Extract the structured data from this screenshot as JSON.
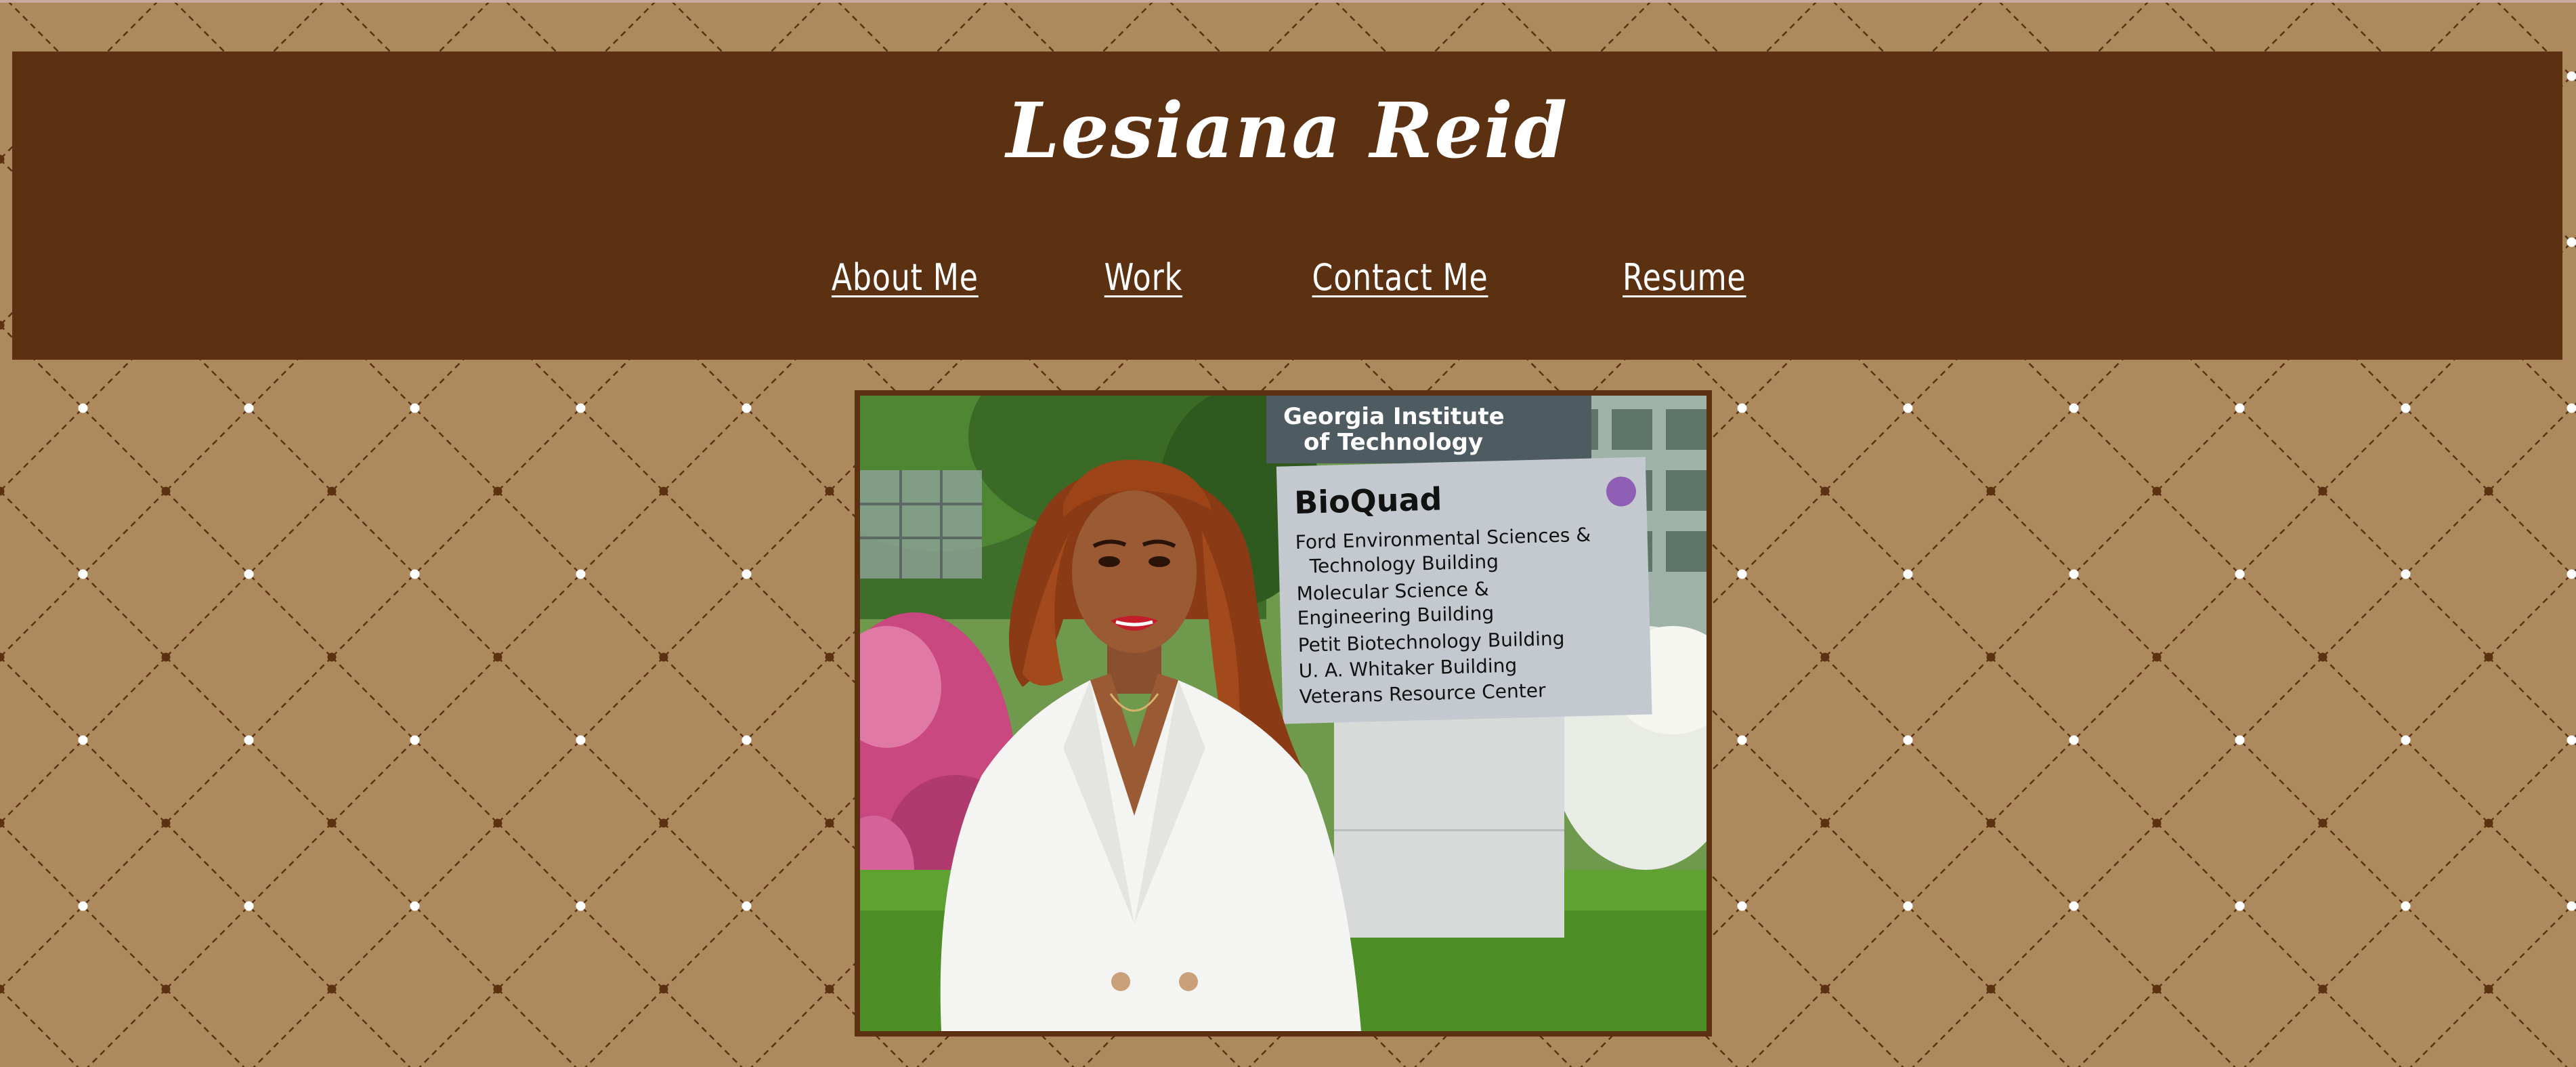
{
  "site": {
    "title": "Lesiana Reid"
  },
  "nav": {
    "items": [
      {
        "label": "About Me"
      },
      {
        "label": "Work"
      },
      {
        "label": "Contact Me"
      },
      {
        "label": "Resume"
      }
    ]
  },
  "photo": {
    "sign": {
      "logo_line1": "Georgia Institute",
      "logo_line2": "of Technology",
      "heading": "BioQuad",
      "lines": [
        "Ford Environmental Sciences &",
        "Technology Building",
        "Molecular Science &",
        "Engineering Building",
        "Petit Biotechnology Building",
        "U. A. Whitaker Building",
        "Veterans Resource Center"
      ]
    }
  },
  "colors": {
    "background": "#ad8a5e",
    "header": "#5c3112",
    "title_text": "#ffffff",
    "nav_text": "#ffffff",
    "pattern_line": "#5c3112",
    "pattern_white_dot": "#ffffff",
    "pattern_dark_dot": "#5c3112"
  }
}
